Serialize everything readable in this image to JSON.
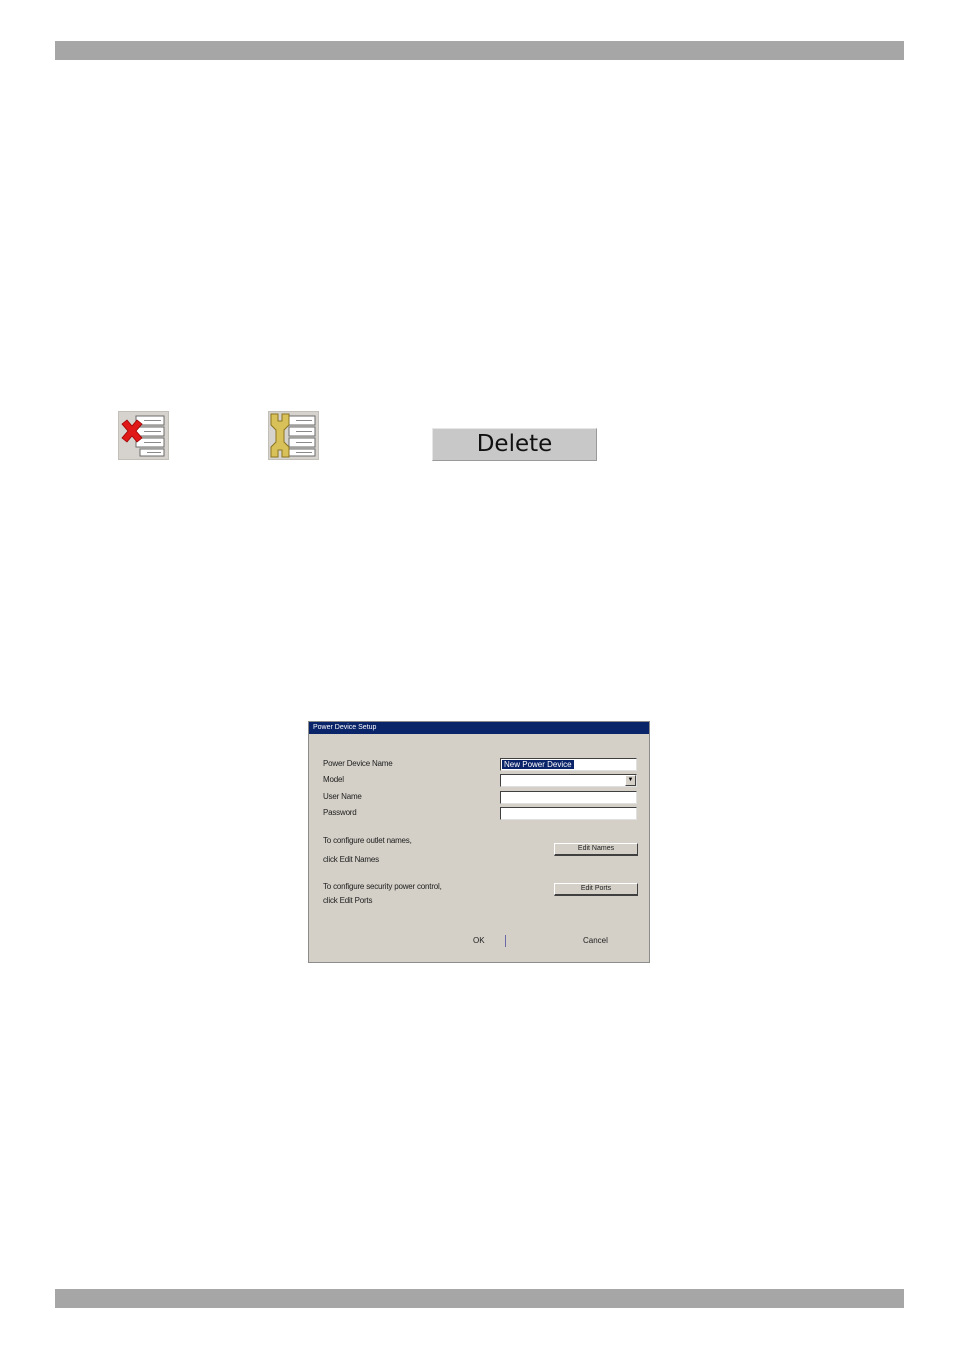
{
  "icons": {
    "delete_icon": "server-list-delete-icon",
    "modify_icon": "server-list-wrench-icon"
  },
  "delete_button": {
    "label": "Delete"
  },
  "dialog": {
    "title": "Power Device Setup",
    "fields": [
      {
        "label": "Power Device Name",
        "value": "New Power Device",
        "kind": "text"
      },
      {
        "label": "Model",
        "value": "",
        "kind": "select"
      },
      {
        "label": "User Name",
        "value": "",
        "kind": "text"
      },
      {
        "label": "Password",
        "value": "",
        "kind": "text"
      }
    ],
    "section1": {
      "line1": "To configure outlet names,",
      "line2": "click Edit Names",
      "button": "Edit Names"
    },
    "section2": {
      "line1": "To configure security power control,",
      "line2": "click Edit Ports",
      "button": "Edit Ports"
    },
    "ok_button": "OK",
    "cancel_button": "Cancel"
  },
  "colors": {
    "header_bar": "#a6a6a6",
    "dialog_title_bar": "#0a246a",
    "dialog_bg": "#d4d0c8"
  }
}
